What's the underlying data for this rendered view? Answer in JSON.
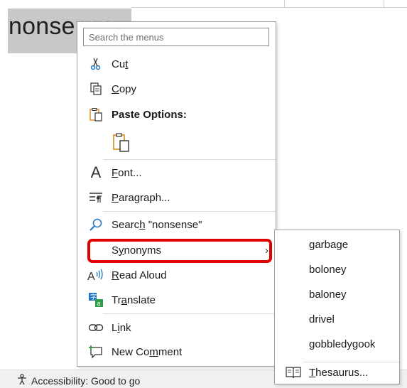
{
  "document": {
    "selected_word": "nonsense"
  },
  "context_menu": {
    "search_placeholder": "Search the menus",
    "cut": {
      "pre": "Cu",
      "u": "t",
      "post": ""
    },
    "copy": {
      "pre": "",
      "u": "C",
      "post": "opy"
    },
    "paste_options": "Paste Options:",
    "font": {
      "pre": "",
      "u": "F",
      "post": "ont..."
    },
    "paragraph": {
      "pre": "",
      "u": "P",
      "post": "aragraph..."
    },
    "search": {
      "pre": "Searc",
      "u": "h",
      "post": " \"nonsense\""
    },
    "synonyms": {
      "pre": "S",
      "u": "y",
      "post": "nonyms"
    },
    "read_aloud": {
      "pre": "",
      "u": "R",
      "post": "ead Aloud"
    },
    "translate": {
      "pre": "Tr",
      "u": "a",
      "post": "nslate"
    },
    "link": {
      "pre": "L",
      "u": "i",
      "post": "nk"
    },
    "new_comment": {
      "pre": "New Co",
      "u": "m",
      "post": "ment"
    }
  },
  "synonyms_submenu": {
    "items": [
      "garbage",
      "boloney",
      "baloney",
      "drivel",
      "gobbledygook"
    ],
    "thesaurus": {
      "pre": "",
      "u": "T",
      "post": "hesaurus..."
    }
  },
  "status_bar": {
    "accessibility": "Accessibility: Good to go"
  },
  "colors": {
    "highlight": "#e10000",
    "icon_blue": "#1e73be",
    "icon_orange": "#d98a1c"
  }
}
